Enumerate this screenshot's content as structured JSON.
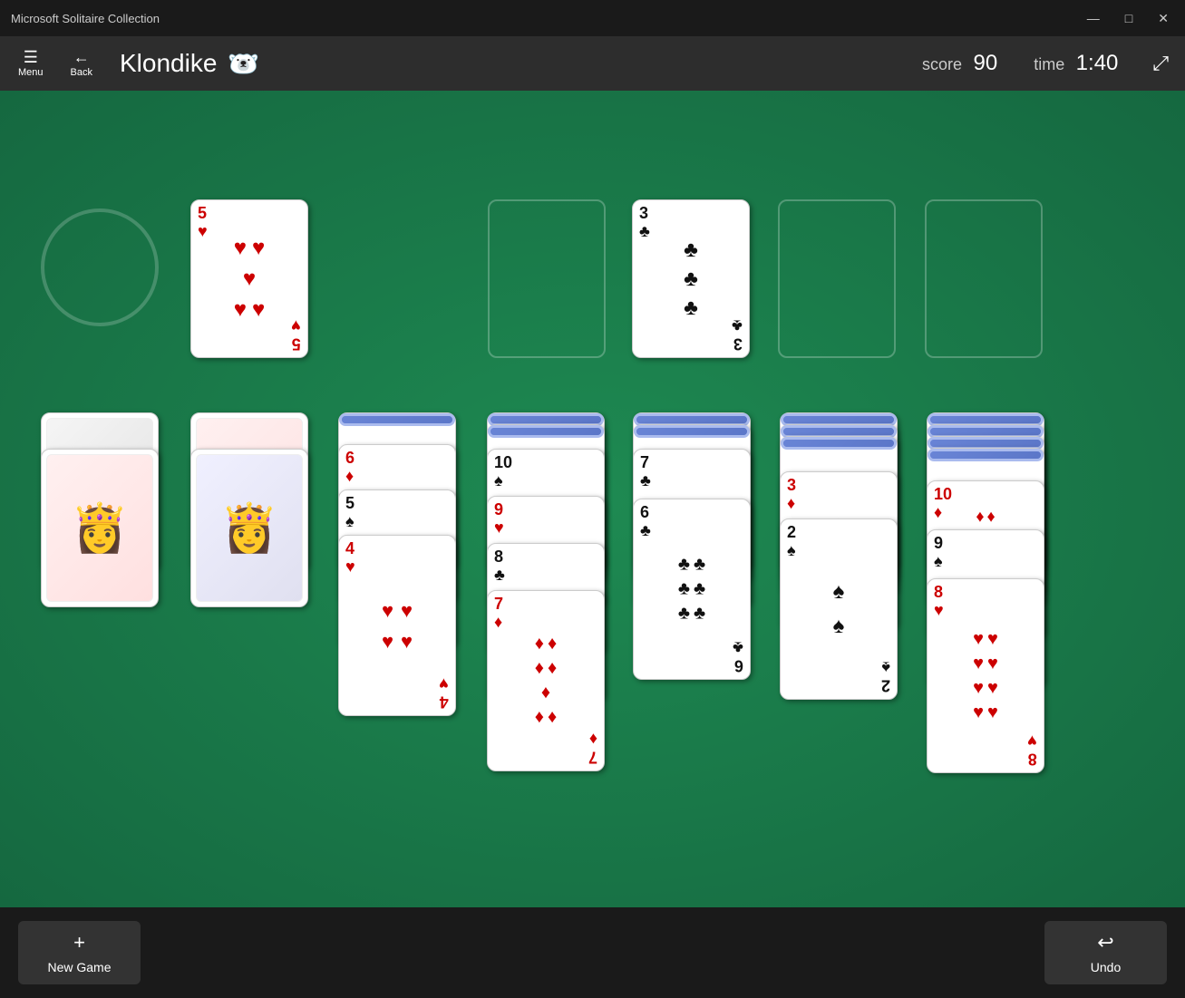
{
  "window": {
    "title": "Microsoft Solitaire Collection",
    "controls": {
      "minimize": "—",
      "maximize": "□",
      "close": "✕"
    }
  },
  "header": {
    "menu_label": "Menu",
    "back_label": "Back",
    "game_title": "Klondike",
    "score_label": "score",
    "score_value": "90",
    "time_label": "time",
    "time_value": "1:40"
  },
  "bottom": {
    "new_game_label": "New Game",
    "new_game_icon": "+",
    "undo_label": "Undo",
    "undo_icon": "↩"
  }
}
